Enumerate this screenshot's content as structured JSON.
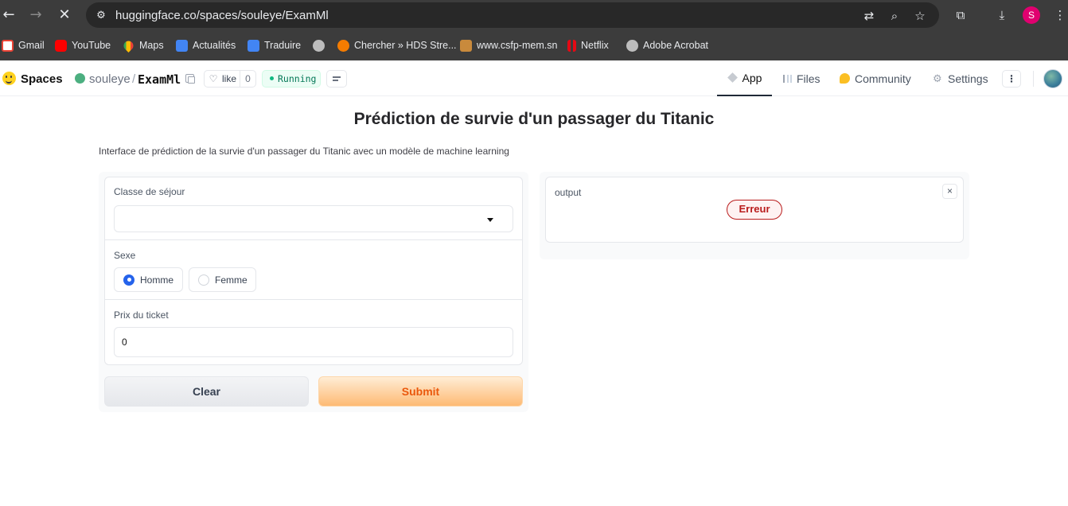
{
  "browser": {
    "url": "huggingface.co/spaces/souleye/ExamMl",
    "bookmarks": [
      {
        "label": "Gmail",
        "icon": "gmail-icon"
      },
      {
        "label": "YouTube",
        "icon": "youtube-icon"
      },
      {
        "label": "Maps",
        "icon": "maps-icon"
      },
      {
        "label": "Actualités",
        "icon": "news-icon"
      },
      {
        "label": "Traduire",
        "icon": "translate-icon"
      },
      {
        "label": "",
        "icon": "globe-icon"
      },
      {
        "label": "Chercher » HDS Stre...",
        "icon": "play-icon"
      },
      {
        "label": "www.csfp-mem.sn",
        "icon": "site-icon"
      },
      {
        "label": "Netflix",
        "icon": "netflix-icon"
      },
      {
        "label": "Adobe Acrobat",
        "icon": "globe-icon"
      }
    ],
    "profile_initial": "S"
  },
  "hf_header": {
    "spaces_label": "Spaces",
    "owner": "souleye",
    "repo": "ExamMl",
    "like_label": "like",
    "like_count": "0",
    "status": "Running",
    "tabs": [
      {
        "label": "App",
        "active": true,
        "icon": "cube-icon"
      },
      {
        "label": "Files",
        "active": false,
        "icon": "files-icon"
      },
      {
        "label": "Community",
        "active": false,
        "icon": "community-icon"
      },
      {
        "label": "Settings",
        "active": false,
        "icon": "gear-icon"
      }
    ],
    "more_label": "⋮"
  },
  "app": {
    "title": "Prédiction de survie d'un passager du Titanic",
    "description": "Interface de prédiction de la survie d'un passager du Titanic avec un modèle de machine learning",
    "fields": {
      "class_label": "Classe de séjour",
      "class_value": "",
      "sex_label": "Sexe",
      "sex_options": [
        {
          "label": "Homme",
          "selected": true
        },
        {
          "label": "Femme",
          "selected": false
        }
      ],
      "price_label": "Prix du ticket",
      "price_value": "0"
    },
    "buttons": {
      "clear": "Clear",
      "submit": "Submit"
    },
    "output": {
      "label": "output",
      "error": "Erreur",
      "close": "×"
    }
  },
  "colors": {
    "accent_blue": "#2563eb",
    "submit_orange": "#ea580c",
    "error_red": "#b91c1c",
    "running_green": "#047857"
  }
}
